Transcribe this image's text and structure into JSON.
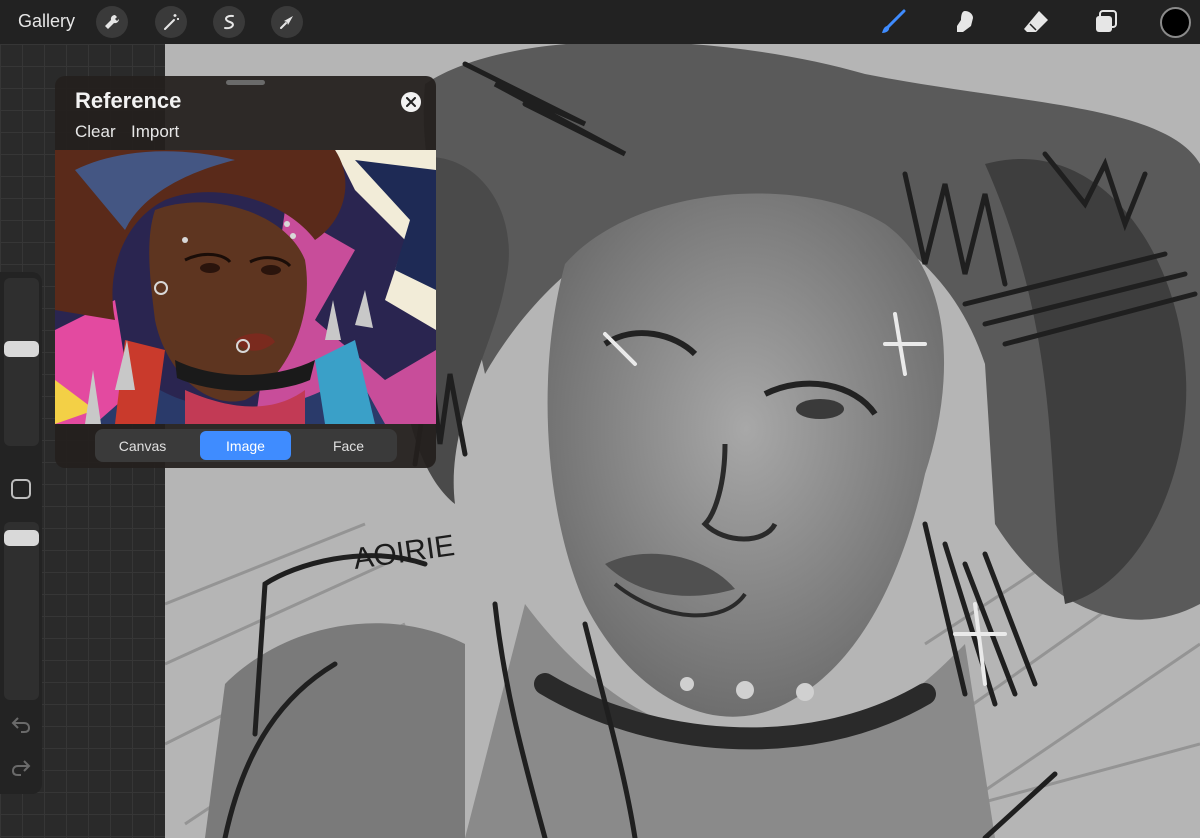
{
  "topbar": {
    "gallery_label": "Gallery",
    "left_tools": [
      "wrench-icon",
      "magic-wand-icon",
      "selection-icon",
      "transform-icon"
    ],
    "right_tools": [
      "brush-icon",
      "smudge-icon",
      "eraser-icon",
      "layers-icon"
    ],
    "active_tool": "brush-icon",
    "accent_color": "#3f8cff",
    "current_color": "#000000"
  },
  "reference": {
    "title": "Reference",
    "clear_label": "Clear",
    "import_label": "Import",
    "tabs": [
      {
        "label": "Canvas",
        "active": false
      },
      {
        "label": "Image",
        "active": true
      },
      {
        "label": "Face",
        "active": false
      }
    ]
  },
  "sidebar": {
    "brush_size_level": 0.78,
    "opacity_level": 0.98
  },
  "canvas": {
    "signature_text": "AOIRIE"
  }
}
